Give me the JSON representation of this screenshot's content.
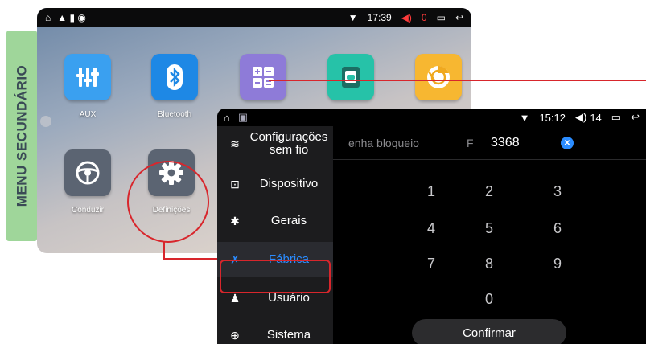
{
  "side_label": "MENU SECUNDÁRIO",
  "home_screen": {
    "status_time": "17:39",
    "volume": "0",
    "apps": [
      {
        "label": "AUX",
        "icon": "aux-equalizer-icon",
        "color": "#3aa0f0"
      },
      {
        "label": "Bluetooth",
        "icon": "bluetooth-icon",
        "color": "#1e88e5"
      },
      {
        "label": "",
        "icon": "calculator-icon",
        "color": "#8e7bd8"
      },
      {
        "label": "",
        "icon": "car-phone-icon",
        "color": "#26c2a8"
      },
      {
        "label": "",
        "icon": "chrome-icon",
        "color": "#f7b731"
      },
      {
        "label": "Conduzir",
        "icon": "steering-wheel-icon",
        "color": "#5b6472"
      },
      {
        "label": "Definições",
        "icon": "gear-icon",
        "color": "#5b6472"
      }
    ]
  },
  "settings_screen": {
    "status_time": "15:12",
    "volume": "14",
    "sidebar": [
      {
        "label": "Configurações sem fio",
        "icon": "wifi-icon"
      },
      {
        "label": "Dispositivo",
        "icon": "device-icon"
      },
      {
        "label": "Gerais",
        "icon": "gear-icon"
      },
      {
        "label": "Fábrica",
        "icon": "tools-icon",
        "active": true
      },
      {
        "label": "Usuário",
        "icon": "user-icon"
      },
      {
        "label": "Sistema",
        "icon": "globe-icon"
      }
    ],
    "password_label": "enha bloqueio",
    "password_prefix": "F",
    "password_value": "3368",
    "keypad": [
      "1",
      "2",
      "3",
      "4",
      "5",
      "6",
      "7",
      "8",
      "9",
      "0"
    ],
    "confirm_label": "Confirmar"
  },
  "colors": {
    "accent": "#2b8cff",
    "annotation_red": "#d8262c",
    "label_green": "#9fd69a"
  }
}
